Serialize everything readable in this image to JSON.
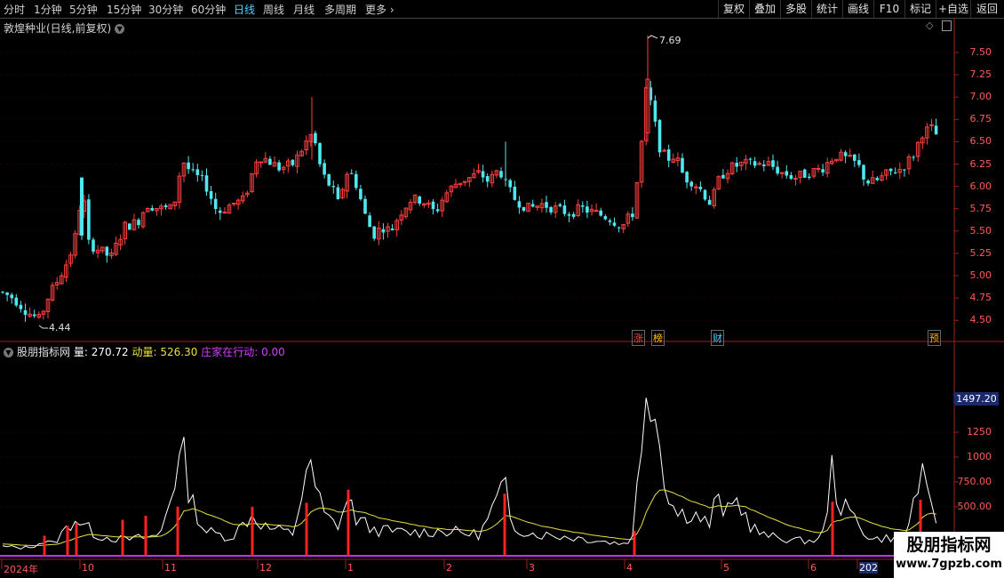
{
  "toolbar": {
    "periods": [
      {
        "label": "分时"
      },
      {
        "label": "1分钟"
      },
      {
        "label": "5分钟"
      },
      {
        "label": "15分钟"
      },
      {
        "label": "30分钟"
      },
      {
        "label": "60分钟"
      },
      {
        "label": "日线",
        "active": true
      },
      {
        "label": "周线"
      },
      {
        "label": "月线"
      },
      {
        "label": "多周期"
      },
      {
        "label": "更多"
      }
    ],
    "tools": [
      {
        "label": "复权"
      },
      {
        "label": "叠加"
      },
      {
        "label": "多股"
      },
      {
        "label": "统计"
      },
      {
        "label": "画线"
      },
      {
        "label": "F10"
      },
      {
        "label": "标记"
      },
      {
        "label": "+自选"
      },
      {
        "label": "返回"
      }
    ]
  },
  "main": {
    "title": "敦煌种业(日线,前复权)",
    "high_label": "7.69",
    "low_label": "4.44",
    "price_axis": [
      "7.50",
      "7.25",
      "7.00",
      "6.75",
      "6.50",
      "6.25",
      "6.00",
      "5.75",
      "5.50",
      "5.25",
      "5.00",
      "4.75",
      "4.50"
    ],
    "markers": [
      {
        "text": "涨",
        "color": "#ff4040"
      },
      {
        "text": "榜",
        "color": "#ffcc00"
      },
      {
        "text": "财",
        "color": "#4fd1ff"
      },
      {
        "text": "预",
        "color": "#ffaa00"
      }
    ]
  },
  "sub": {
    "name": "股朋指标网",
    "vol_label": "量: 270.72",
    "mavol_label": "动量: 526.30",
    "zhuang_label": "庄家在行动: 0.00",
    "vol_axis": [
      "1250",
      "1000",
      "750.00",
      "500.00"
    ],
    "vol_current": "1497.20"
  },
  "dates": [
    "2024年",
    "10",
    "11",
    "12",
    "1",
    "2",
    "3",
    "4",
    "5",
    "6",
    "202"
  ],
  "watermark": {
    "main": "股朋指标网",
    "url": "www.7gpzb.com"
  },
  "colors": {
    "up": "#ff4040",
    "down": "#4fe8f0",
    "axis": "#ff5a5a",
    "vol": "#ffffff",
    "mavol": "#e8e040",
    "spike": "#ff2020",
    "baseline": "#c030ff"
  }
}
